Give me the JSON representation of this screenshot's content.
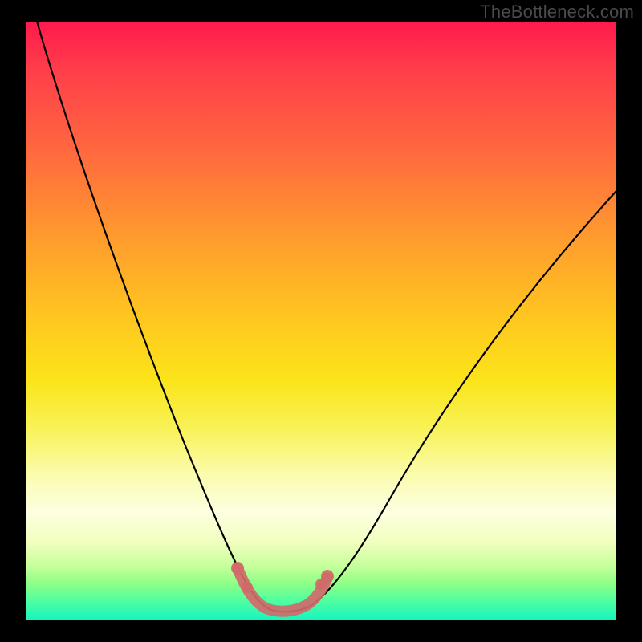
{
  "watermark": "TheBottleneck.com",
  "colors": {
    "frame_bg": "#000000",
    "watermark_text": "#4a4a4a",
    "curve_stroke": "#000000",
    "accent_stroke": "#d16a6a",
    "gradient_stops": [
      "#ff1a4d",
      "#ff3e4a",
      "#ff6a3e",
      "#ff9b2e",
      "#ffc81f",
      "#fbe41a",
      "#f8f257",
      "#fbfcb0",
      "#fdffe0",
      "#f1ffbf",
      "#c6ff9b",
      "#8dff86",
      "#4dffa2",
      "#17f5bd"
    ]
  },
  "chart_data": {
    "type": "line",
    "title": "",
    "xlabel": "",
    "ylabel": "",
    "xlim": [
      0,
      100
    ],
    "ylim": [
      0,
      100
    ],
    "grid": false,
    "legend_position": "none",
    "x": [
      0,
      5,
      10,
      15,
      20,
      25,
      30,
      33,
      36,
      38,
      40,
      42,
      44,
      48,
      52,
      56,
      60,
      65,
      70,
      75,
      80,
      85,
      90,
      95,
      100
    ],
    "series": [
      {
        "name": "bottleneck-curve",
        "values": [
          100,
          88,
          76,
          64,
          52,
          40,
          28,
          18,
          10,
          6,
          3,
          1,
          1,
          2,
          4,
          8,
          14,
          22,
          30,
          38,
          46,
          54,
          61,
          67,
          72
        ]
      }
    ],
    "annotations": [
      {
        "name": "highlighted-minimum-band",
        "x_range": [
          34,
          46
        ],
        "y_range": [
          1,
          12
        ],
        "color": "#d16a6a"
      }
    ]
  }
}
